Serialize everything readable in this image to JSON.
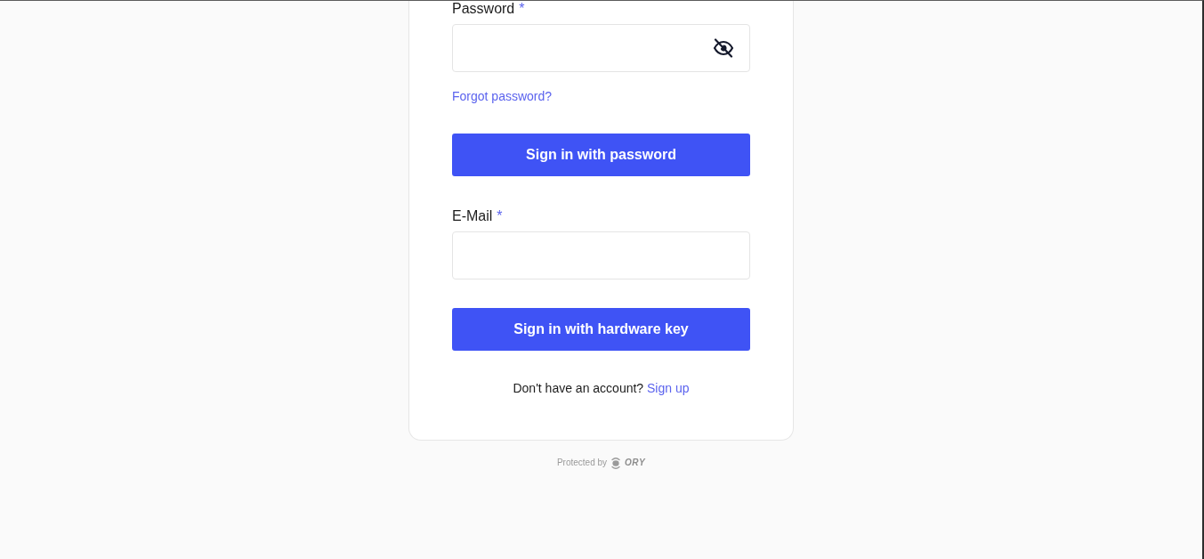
{
  "form": [
    {
      "kind": "password",
      "label": "Password",
      "required_mark": "*"
    },
    {
      "kind": "link",
      "text": "Forgot password?"
    },
    {
      "kind": "button",
      "label": "Sign in with password"
    },
    {
      "kind": "email",
      "label": "E-Mail",
      "required_mark": "*"
    },
    {
      "kind": "button",
      "label": "Sign in with hardware key"
    }
  ],
  "signup_prompt": {
    "text": "Don't have an account?",
    "link": "Sign up"
  },
  "footer": {
    "text": "Protected by",
    "logo_text": "ORY"
  }
}
